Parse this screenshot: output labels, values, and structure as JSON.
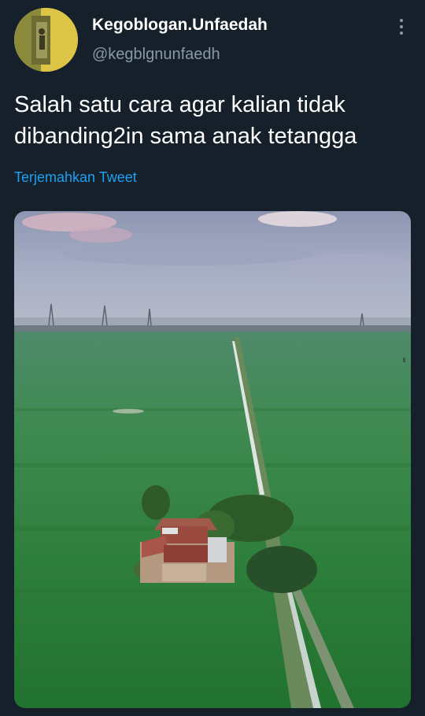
{
  "tweet": {
    "display_name": "Kegoblogan.Unfaedah",
    "handle": "@kegblgnunfaedh",
    "text_lines": [
      "Salah satu cara agar kalian tidak",
      "dibanding2in sama anak tetangga"
    ],
    "translate_label": "Terjemahkan Tweet"
  },
  "icons": {
    "more": "more-vertical-icon"
  },
  "colors": {
    "background": "#15202b",
    "link": "#1da1f2",
    "secondary_text": "#8899a6"
  }
}
